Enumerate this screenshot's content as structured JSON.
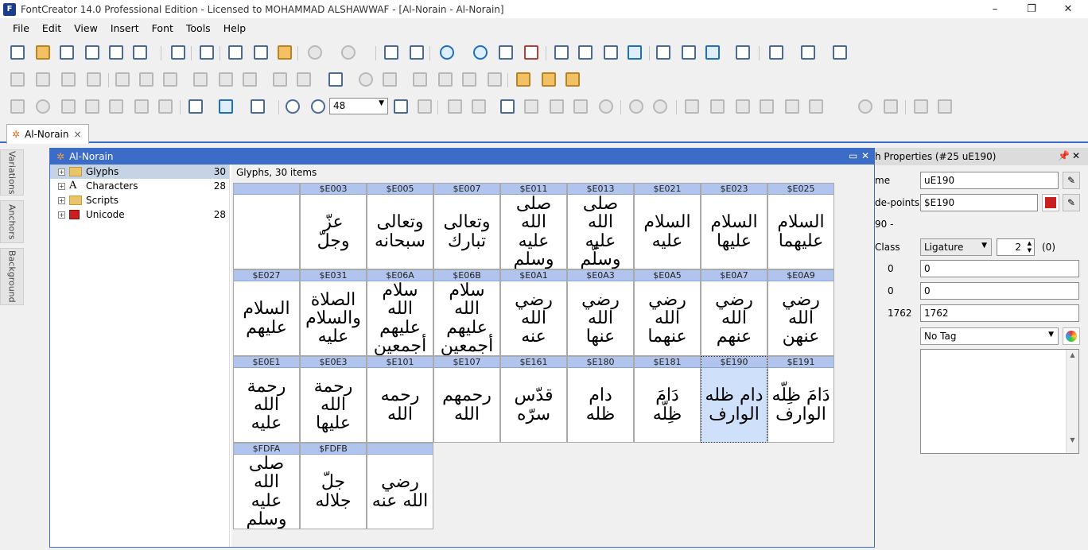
{
  "window": {
    "title": "FontCreator 14.0 Professional Edition - Licensed to MOHAMMAD ALSHAWWAF - [Al-Norain  - Al-Norain]",
    "app_icon": "F"
  },
  "menu": [
    "File",
    "Edit",
    "View",
    "Insert",
    "Font",
    "Tools",
    "Help"
  ],
  "toolbar": {
    "zoom_value": "48"
  },
  "document_tab": {
    "label": "Al-Norain",
    "close": "×"
  },
  "side_tabs": [
    "Variations",
    "Anchors",
    "Background"
  ],
  "font_window": {
    "title": "Al-Norain",
    "tree": [
      {
        "label": "Glyphs",
        "count": "30",
        "selected": true
      },
      {
        "label": "Characters",
        "count": "28"
      },
      {
        "label": "Scripts",
        "count": ""
      },
      {
        "label": "Unicode",
        "count": "28"
      }
    ],
    "caption": "Glyphs, 30 items",
    "cells": [
      {
        "code": "",
        "glyph": ""
      },
      {
        "code": "$E003",
        "glyph": "عزّ\nوجلّ"
      },
      {
        "code": "$E005",
        "glyph": "وتعالى\nسبحانه"
      },
      {
        "code": "$E007",
        "glyph": "وتعالى\nتبارك"
      },
      {
        "code": "$E011",
        "glyph": "صلى الله\nعليه وسلم"
      },
      {
        "code": "$E013",
        "glyph": "صلى الله\nعليه وسلّم"
      },
      {
        "code": "$E021",
        "glyph": "السلام\nعليه"
      },
      {
        "code": "$E023",
        "glyph": "السلام\nعليها"
      },
      {
        "code": "$E025",
        "glyph": "السلام\nعليهما"
      },
      {
        "code": "$E027",
        "glyph": "السلام\nعليهم"
      },
      {
        "code": "$E031",
        "glyph": "الصلاة والسلام\nعليه"
      },
      {
        "code": "$E06A",
        "glyph": "سلام الله\nعليهم أجمعين"
      },
      {
        "code": "$E06B",
        "glyph": "سلام الله\nعليهم أجمعين"
      },
      {
        "code": "$E0A1",
        "glyph": "رضي الله\nعنه"
      },
      {
        "code": "$E0A3",
        "glyph": "رضي الله\nعنها"
      },
      {
        "code": "$E0A5",
        "glyph": "رضي الله\nعنهما"
      },
      {
        "code": "$E0A7",
        "glyph": "رضي الله\nعنهم"
      },
      {
        "code": "$E0A9",
        "glyph": "رضي الله\nعنهن"
      },
      {
        "code": "$E0E1",
        "glyph": "رحمة الله\nعليه"
      },
      {
        "code": "$E0E3",
        "glyph": "رحمة الله\nعليها"
      },
      {
        "code": "$E101",
        "glyph": "رحمه الله"
      },
      {
        "code": "$E107",
        "glyph": "رحمهم الله"
      },
      {
        "code": "$E161",
        "glyph": "قدّس\nسرّه"
      },
      {
        "code": "$E180",
        "glyph": "دام\nظله"
      },
      {
        "code": "$E181",
        "glyph": "دَامَ\nظِلّه"
      },
      {
        "code": "$E190",
        "glyph": "دام ظله\nالوارف",
        "selected": true
      },
      {
        "code": "$E191",
        "glyph": "دَامَ ظِلّه\nالوارف"
      },
      {
        "code": "$FDFA",
        "glyph": "صلى الله\nعليه وسلم"
      },
      {
        "code": "$FDFB",
        "glyph": "جلّ\nجلاله"
      },
      {
        "code": "",
        "glyph": "رضي\nالله عنه"
      }
    ]
  },
  "properties": {
    "title": "h Properties (#25 uE190)",
    "labels": {
      "name": "me",
      "codepoints": "de-points",
      "range": "90 -",
      "class": "Class",
      "v1": "0",
      "v2": "0",
      "v3": "1762"
    },
    "name_value": "uE190",
    "codepoints_value": "$E190",
    "class_value": "Ligature",
    "spin_value": "2",
    "spin_note": "(0)",
    "field1": "0",
    "field2": "0",
    "field3": "1762",
    "tag_value": "No Tag"
  }
}
